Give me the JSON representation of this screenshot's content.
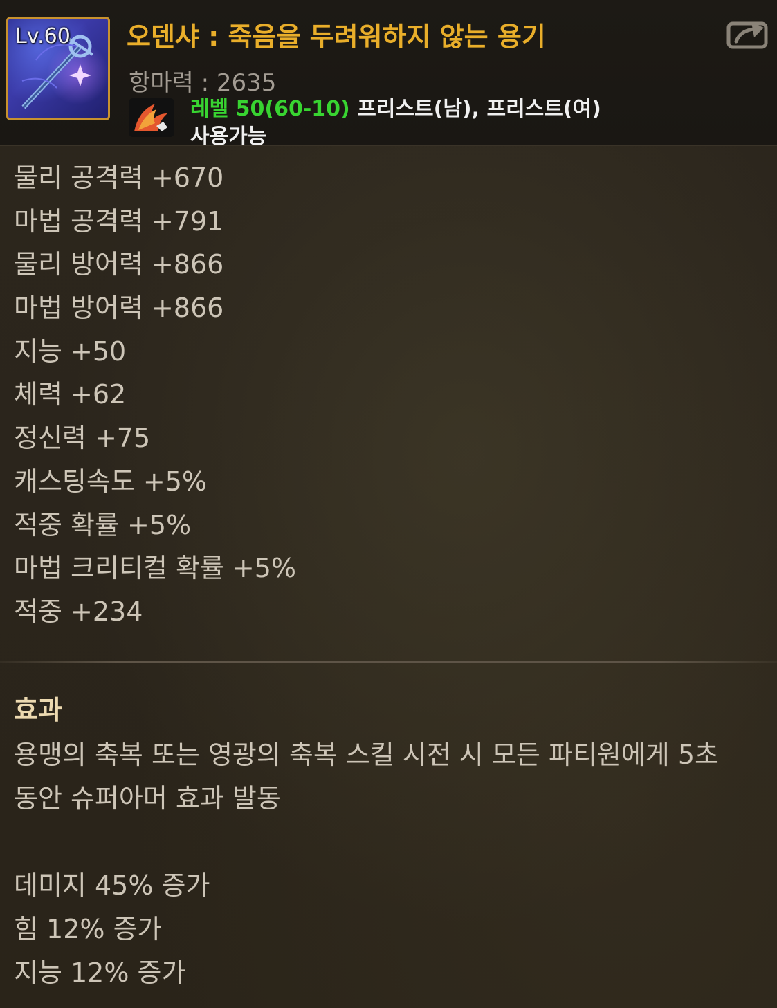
{
  "item": {
    "level_badge": "Lv.60",
    "name": "오덴샤 : 죽음을 두려워하지 않는 용기",
    "resist": "항마력 : 2635",
    "requirement_level": "레벨 50(60-10)",
    "requirement_classes": " 프리스트(남), 프리스트(여)",
    "usable": "사용가능",
    "icon": "holy-staff-icon",
    "class_icon": "priest-wing-icon",
    "share_icon": "share-export-icon"
  },
  "stats": [
    "물리 공격력 +670",
    "마법 공격력 +791",
    "물리 방어력 +866",
    "마법 방어력 +866",
    "지능 +50",
    "체력 +62",
    "정신력 +75",
    "캐스팅속도 +5%",
    "적중 확률 +5%",
    "마법 크리티컬 확률 +5%",
    "적중 +234"
  ],
  "effect": {
    "heading": "효과",
    "description": "용맹의 축복 또는 영광의 축복 스킬 시전 시 모든 파티원에게 5초 동안 슈퍼아머 효과 발동",
    "bonuses": [
      "데미지 45% 증가",
      "힘 12% 증가",
      "지능 12% 증가"
    ]
  },
  "colors": {
    "title": "#e9ae2a",
    "level_requirement": "#38d431",
    "stat_text": "#cdc5b7",
    "icon_border": "#c8922e"
  }
}
